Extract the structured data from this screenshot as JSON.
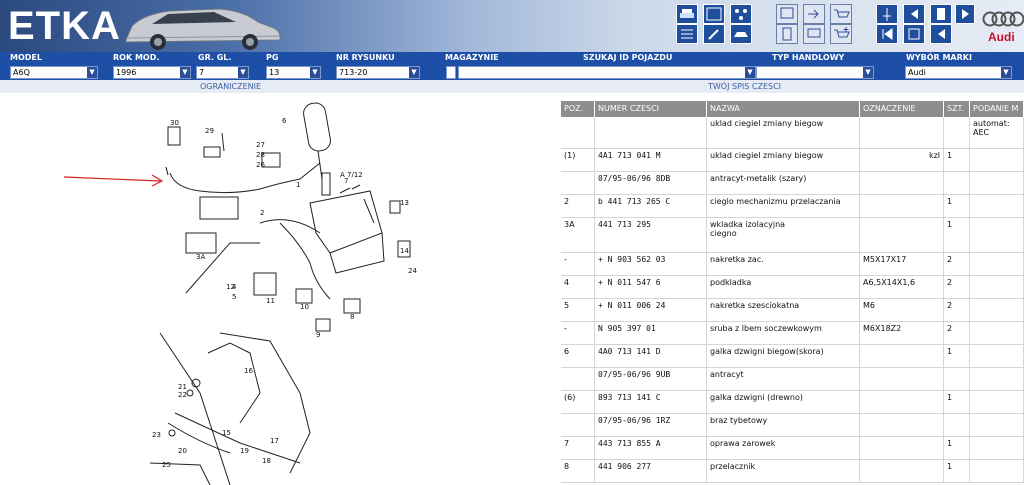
{
  "app": {
    "logo": "ETKA",
    "brand": "Audi"
  },
  "toolbar": {
    "icons": [
      "print-icon",
      "window-icon",
      "network-icon",
      "list-icon",
      "edit-icon",
      "vehicle-icon",
      "info-icon",
      "export-icon",
      "cart-icon",
      "document-icon",
      "cart-add-icon",
      "pin-icon",
      "first-page-icon",
      "page-icon",
      "last-page-icon",
      "expand-icon",
      "back-icon"
    ]
  },
  "selectors": {
    "model": {
      "label": "MODEL",
      "value": "A6Q"
    },
    "rok": {
      "label": "ROK MOD.",
      "value": "1996"
    },
    "gr": {
      "label": "GR. GL.",
      "value": "7"
    },
    "pg": {
      "label": "PG",
      "value": "13"
    },
    "nr": {
      "label": "NR RYSUNKU",
      "value": "713-20"
    },
    "mag": {
      "label": "MAGAZYNIE",
      "value": ""
    },
    "szukaj": {
      "label": "SZUKAJ ID POJAZDU",
      "value": ""
    },
    "typ": {
      "label": "TYP HANDLOWY",
      "value": ""
    },
    "marka": {
      "label": "WYBÓR MARKI",
      "value": "Audi"
    }
  },
  "strip": {
    "left": "OGRANICZENIE",
    "right": "TWÓJ SPIS CZESCI"
  },
  "table": {
    "headers": [
      "POZ.",
      "NUMER CZESCI",
      "NAZWA",
      "OZNACZENIE",
      "SZT.",
      "PODANIE M"
    ],
    "rows": [
      {
        "poz": "",
        "nr": "",
        "nazwa": "uklad ciegiel zmiany biegow",
        "ozn": "",
        "szt": "",
        "pod": "automat:\nAEC"
      },
      {
        "poz": "(1)",
        "nr": "  4A1 713 041 M",
        "nazwa": "uklad ciegiel zmiany biegow",
        "ozn": "kzl",
        "szt": "1",
        "pod": ""
      },
      {
        "poz": "",
        "nr": "  07/95-06/96 8DB",
        "nazwa": "antracyt-metalik (szary)",
        "ozn": "",
        "szt": "",
        "pod": ""
      },
      {
        "poz": "2",
        "nr": "b 441 713 265 C",
        "nazwa": "cieglo mechanizmu przelaczania",
        "ozn": "",
        "szt": "1",
        "pod": ""
      },
      {
        "poz": "3A",
        "nr": "  441 713 295",
        "nazwa": "wkladka izolacyjna\nciegno",
        "ozn": "",
        "szt": "1",
        "pod": ""
      },
      {
        "poz": "-",
        "nr": "+ N   903 562 03",
        "nazwa": "nakretka zac.",
        "ozn": "M5X17X17",
        "szt": "2",
        "pod": ""
      },
      {
        "poz": "4",
        "nr": "+ N   011 547 6",
        "nazwa": "podkladka",
        "ozn": "A6,5X14X1,6",
        "szt": "2",
        "pod": ""
      },
      {
        "poz": "5",
        "nr": "+ N   011 006 24",
        "nazwa": "nakretka szesciokatna",
        "ozn": "M6",
        "szt": "2",
        "pod": ""
      },
      {
        "poz": "-",
        "nr": "  N   905 397 01",
        "nazwa": "sruba z lbem soczewkowym",
        "ozn": "M6X18Z2",
        "szt": "2",
        "pod": ""
      },
      {
        "poz": "6",
        "nr": "  4A0 713 141 D",
        "nazwa": "galka dzwigni biegow(skora)",
        "ozn": "",
        "szt": "1",
        "pod": ""
      },
      {
        "poz": "",
        "nr": "  07/95-06/96 9UB",
        "nazwa": "antracyt",
        "ozn": "",
        "szt": "",
        "pod": ""
      },
      {
        "poz": "(6)",
        "nr": "  893 713 141 C",
        "nazwa": "galka dzwigni (drewno)",
        "ozn": "",
        "szt": "1",
        "pod": ""
      },
      {
        "poz": "",
        "nr": "  07/95-06/96 1RZ",
        "nazwa": "braz tybetowy",
        "ozn": "",
        "szt": "",
        "pod": ""
      },
      {
        "poz": "7",
        "nr": "  443 713 855 A",
        "nazwa": "oprawa zarowek",
        "ozn": "",
        "szt": "1",
        "pod": ""
      },
      {
        "poz": "8",
        "nr": "  441 906 277",
        "nazwa": "przelacznik",
        "ozn": "",
        "szt": "1",
        "pod": ""
      }
    ]
  },
  "diagram": {
    "labels": [
      "30",
      "29",
      "27",
      "28",
      "26",
      "1",
      "2",
      "3",
      "3A",
      "4",
      "5",
      "6",
      "7",
      "8",
      "9",
      "10",
      "11",
      "12",
      "13",
      "14",
      "15",
      "16",
      "17",
      "18",
      "19",
      "20",
      "21",
      "22",
      "23",
      "24",
      "25"
    ]
  },
  "colors": {
    "bar": "#1e4fa6",
    "header": "#8d8d8d",
    "arrow": "#d42020"
  }
}
